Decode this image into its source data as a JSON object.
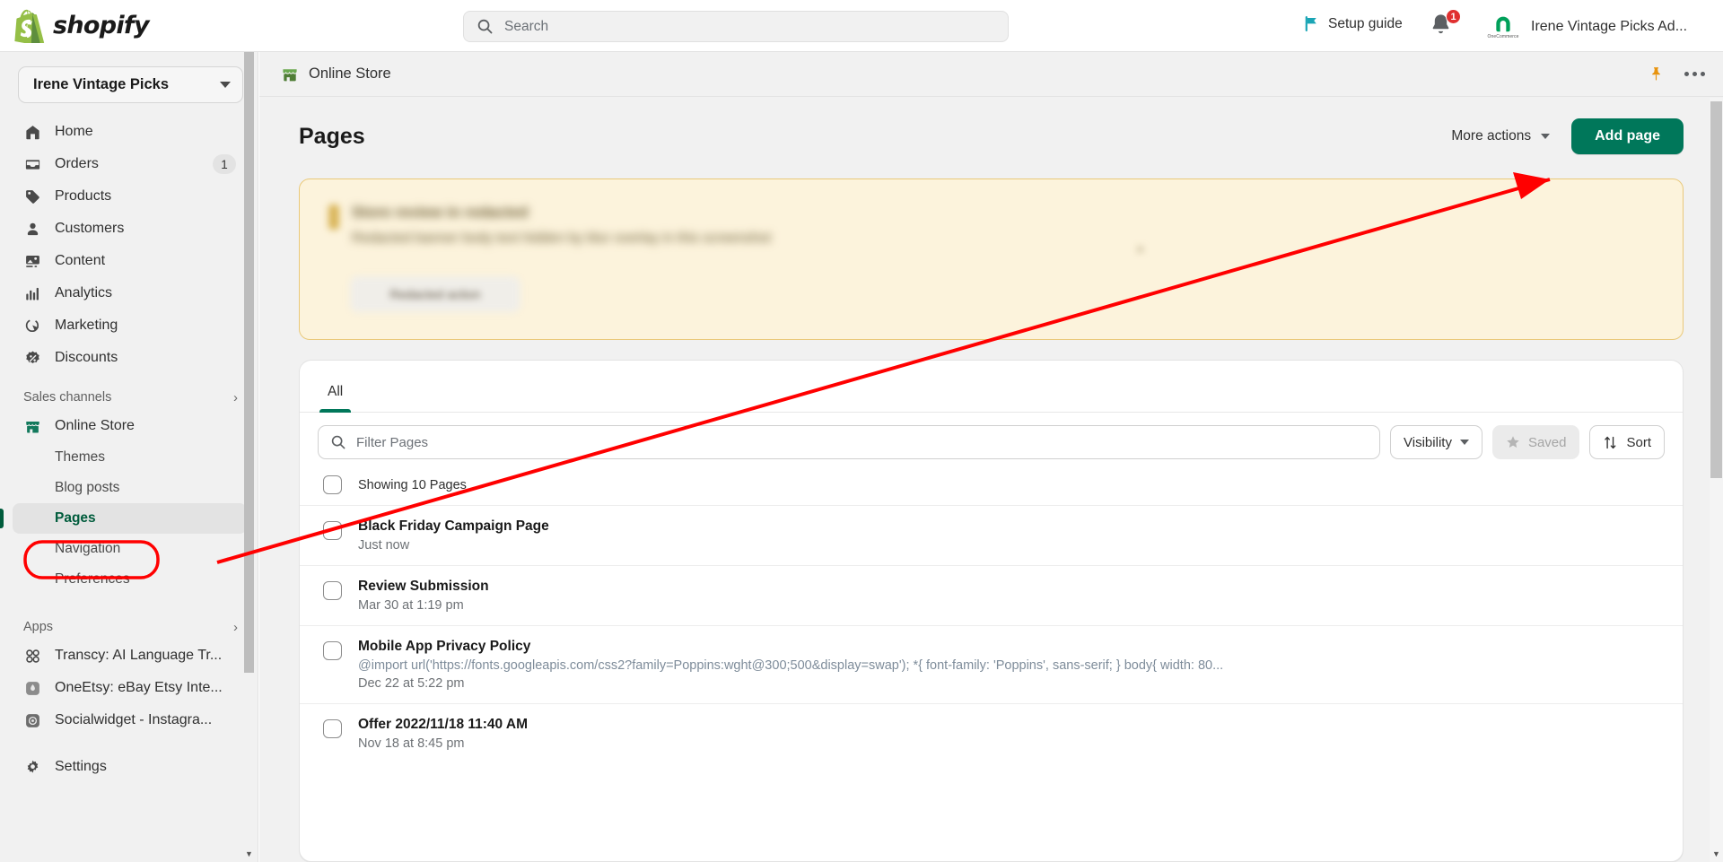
{
  "header": {
    "brand": "shopify",
    "search": {
      "placeholder": "Search",
      "icon": "search-icon"
    },
    "setup_guide": {
      "label": "Setup guide",
      "icon": "flag-icon",
      "color": "#1aa5b5"
    },
    "notifications": {
      "icon": "bell-icon",
      "badge": "1",
      "badge_color": "#e03030"
    },
    "account": {
      "name": "Irene Vintage Picks Ad...",
      "avatar_label": "OneCommerce",
      "avatar_icon": "onecommerce-logo"
    }
  },
  "sidebar": {
    "store_switcher": {
      "name": "Irene Vintage Picks",
      "icon": "chevron-down-icon"
    },
    "items": [
      {
        "label": "Home",
        "icon": "home-icon",
        "count": null
      },
      {
        "label": "Orders",
        "icon": "orders-inbox-icon",
        "count": "1"
      },
      {
        "label": "Products",
        "icon": "tag-icon",
        "count": null
      },
      {
        "label": "Customers",
        "icon": "person-icon",
        "count": null
      },
      {
        "label": "Content",
        "icon": "image-content-icon",
        "count": null
      },
      {
        "label": "Analytics",
        "icon": "bar-chart-icon",
        "count": null
      },
      {
        "label": "Marketing",
        "icon": "marketing-target-icon",
        "count": null
      },
      {
        "label": "Discounts",
        "icon": "discount-badge-icon",
        "count": null
      }
    ],
    "sales_channels": {
      "title": "Sales channels",
      "expander_icon": "chevron-right-icon",
      "channel": {
        "label": "Online Store",
        "icon": "storefront-icon"
      },
      "sub_items": [
        {
          "label": "Themes",
          "active": false
        },
        {
          "label": "Blog posts",
          "active": false
        },
        {
          "label": "Pages",
          "active": true
        },
        {
          "label": "Navigation",
          "active": false
        },
        {
          "label": "Preferences",
          "active": false
        }
      ]
    },
    "apps": {
      "title": "Apps",
      "expander_icon": "chevron-right-icon",
      "items": [
        {
          "label": "Transcy: AI Language Tr...",
          "icon": "transcy-app-icon"
        },
        {
          "label": "OneEtsy: eBay Etsy Inte...",
          "icon": "oneetsy-app-icon"
        },
        {
          "label": "Socialwidget - Instagra...",
          "icon": "socialwidget-app-icon"
        }
      ]
    },
    "settings": {
      "label": "Settings",
      "icon": "gear-icon"
    }
  },
  "context_bar": {
    "title": "Online Store",
    "icon": "storefront-icon",
    "pin_icon": "pin-icon",
    "more_icon": "ellipsis-icon"
  },
  "page": {
    "title": "Pages",
    "more_actions": {
      "label": "More actions",
      "icon": "chevron-down-icon"
    },
    "add_page": {
      "label": "Add page"
    }
  },
  "banner": {
    "redacted": true,
    "title_placeholder": "Store review in redacted",
    "body_placeholder": "Redacted banner body text hidden by blur overlay in this screenshot",
    "button_placeholder": "Redacted action",
    "bg_color": "#fcf3dc",
    "border_color": "#eac97a"
  },
  "list_card": {
    "tabs": [
      {
        "label": "All",
        "active": true
      }
    ],
    "filter": {
      "placeholder": "Filter Pages",
      "icon": "search-icon"
    },
    "controls": [
      {
        "label": "Visibility",
        "icon": "chevron-down-icon",
        "disabled": false,
        "name": "visibility-filter-button"
      },
      {
        "label": "Saved",
        "icon": "star-icon",
        "disabled": true,
        "name": "saved-views-button"
      },
      {
        "label": "Sort",
        "icon": "sort-arrows-icon",
        "disabled": false,
        "name": "sort-button"
      }
    ],
    "showing_label": "Showing 10 Pages",
    "rows": [
      {
        "title": "Black Friday Campaign Page",
        "excerpt": "",
        "meta": "Just now"
      },
      {
        "title": "Review Submission",
        "excerpt": "",
        "meta": "Mar 30 at 1:19 pm"
      },
      {
        "title": "Mobile App Privacy Policy",
        "excerpt": "@import url('https://fonts.googleapis.com/css2?family=Poppins:wght@300;500&display=swap'); *{ font-family: 'Poppins', sans-serif; } body{ width: 80...",
        "meta": "Dec 22 at 5:22 pm"
      },
      {
        "title": "Offer 2022/11/18 11:40 AM",
        "excerpt": "",
        "meta": "Nov 18 at 8:45 pm"
      }
    ]
  },
  "annotation": {
    "arrow_color": "#ff0000",
    "highlight_target": "Pages",
    "arrow_from": "add-page-button",
    "arrow_to": "sidebar-item-pages"
  },
  "colors": {
    "brand_green": "#00775a",
    "active_green": "#005c3c",
    "sidebar_bg": "#f1f1f1",
    "card_bg": "#ffffff"
  }
}
